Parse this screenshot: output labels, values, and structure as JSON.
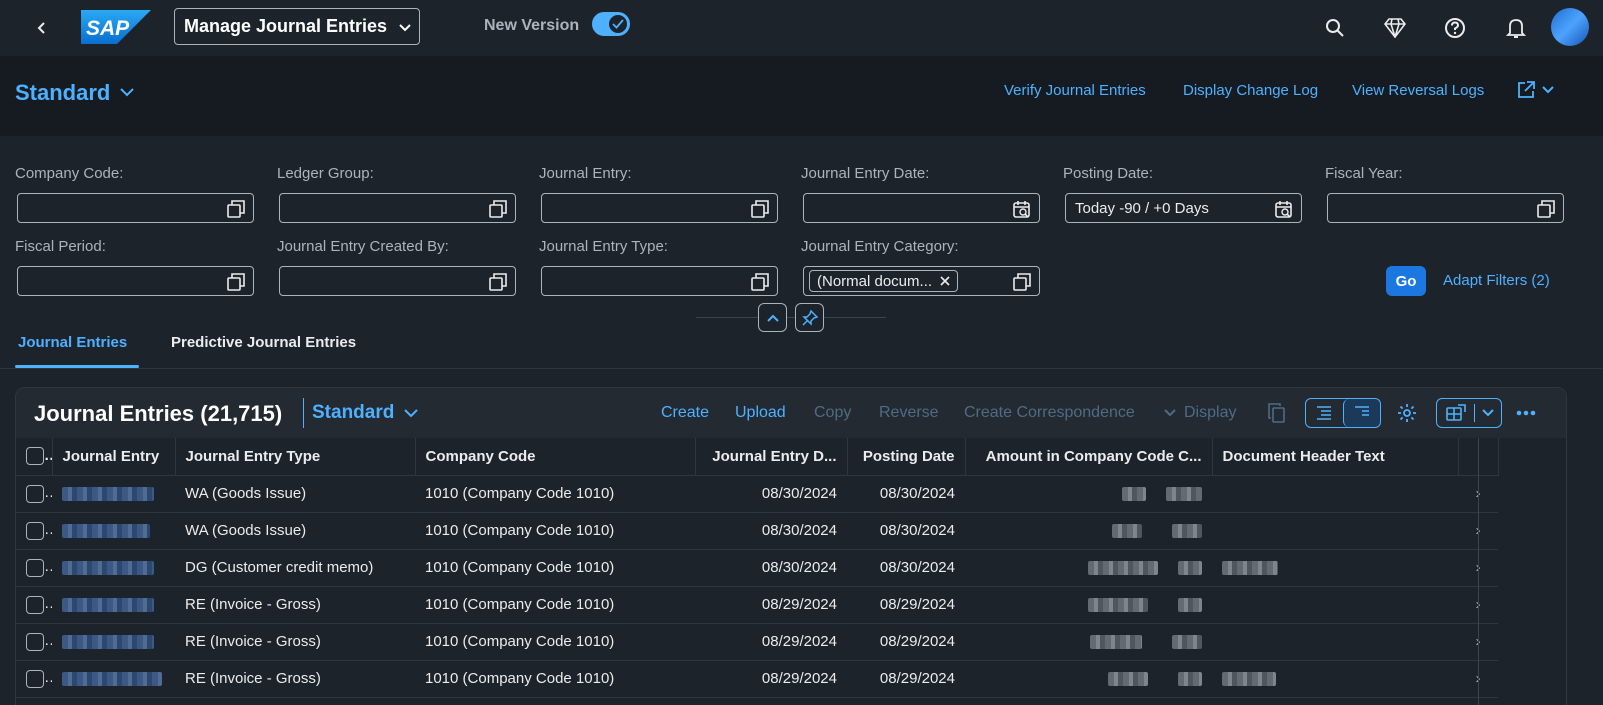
{
  "shell": {
    "app_title": "Manage Journal Entries",
    "new_version_label": "New Version",
    "new_version_on": true,
    "icons": [
      "search-icon",
      "diamond-icon",
      "help-icon",
      "bell-icon"
    ]
  },
  "header": {
    "variant": "Standard",
    "actions": [
      "Verify Journal Entries",
      "Display Change Log",
      "View Reversal Logs"
    ]
  },
  "filters": [
    {
      "label": "Company Code:",
      "value": ""
    },
    {
      "label": "Ledger Group:",
      "value": ""
    },
    {
      "label": "Journal Entry:",
      "value": ""
    },
    {
      "label": "Journal Entry Date:",
      "value": ""
    },
    {
      "label": "Posting Date:",
      "value": "Today -90 / +0 Days"
    },
    {
      "label": "Fiscal Year:",
      "value": ""
    },
    {
      "label": "Fiscal Period:",
      "value": ""
    },
    {
      "label": "Journal Entry Created By:",
      "value": ""
    },
    {
      "label": "Journal Entry Type:",
      "value": ""
    },
    {
      "label": "Journal Entry Category:",
      "token": "(Normal docum..."
    }
  ],
  "filter_actions": {
    "go": "Go",
    "adapt": "Adapt Filters (2)"
  },
  "tabs": [
    {
      "label": "Journal Entries",
      "active": true
    },
    {
      "label": "Predictive Journal Entries",
      "active": false
    }
  ],
  "table": {
    "title": "Journal Entries (21,715)",
    "variant": "Standard",
    "toolbar": [
      {
        "label": "Create",
        "enabled": true
      },
      {
        "label": "Upload",
        "enabled": true
      },
      {
        "label": "Copy",
        "enabled": false
      },
      {
        "label": "Reverse",
        "enabled": false
      },
      {
        "label": "Create Correspondence",
        "enabled": false
      },
      {
        "label": "Display",
        "enabled": false
      }
    ],
    "columns": [
      "Journal Entry",
      "Journal Entry Type",
      "Company Code",
      "Journal Entry D...",
      "Posting Date",
      "Amount in Company Code C...",
      "Document Header Text"
    ],
    "rows": [
      {
        "type": "WA (Goods Issue)",
        "company": "1010 (Company Code 1010)",
        "je_date": "08/30/2024",
        "posting_date": "08/30/2024"
      },
      {
        "type": "WA (Goods Issue)",
        "company": "1010 (Company Code 1010)",
        "je_date": "08/30/2024",
        "posting_date": "08/30/2024"
      },
      {
        "type": "DG (Customer credit memo)",
        "company": "1010 (Company Code 1010)",
        "je_date": "08/30/2024",
        "posting_date": "08/30/2024"
      },
      {
        "type": "RE (Invoice - Gross)",
        "company": "1010 (Company Code 1010)",
        "je_date": "08/29/2024",
        "posting_date": "08/29/2024"
      },
      {
        "type": "RE (Invoice - Gross)",
        "company": "1010 (Company Code 1010)",
        "je_date": "08/29/2024",
        "posting_date": "08/29/2024"
      },
      {
        "type": "RE (Invoice - Gross)",
        "company": "1010 (Company Code 1010)",
        "je_date": "08/29/2024",
        "posting_date": "08/29/2024"
      }
    ]
  },
  "colors": {
    "accent": "#4db1ff",
    "background": "#1d232a",
    "header": "#161b21",
    "button": "#1b78e0"
  }
}
